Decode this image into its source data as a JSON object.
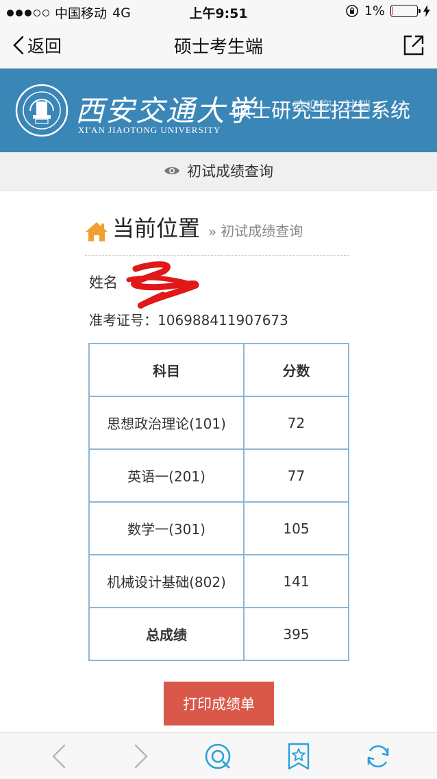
{
  "status_bar": {
    "carrier": "中国移动",
    "network": "4G",
    "time": "上午9:51",
    "battery": "1%",
    "battery_level": 0.01
  },
  "nav": {
    "back_label": "返回",
    "title": "硕士考生端"
  },
  "banner": {
    "university_name": "西安交通大学",
    "university_en": "XI'AN JIAOTONG UNIVERSITY",
    "system_title": "硕士研究生招生系统",
    "welcome": "欢迎您 · 注销"
  },
  "section": {
    "label": "初试成绩查询"
  },
  "location": {
    "title": "当前位置",
    "separator": "»",
    "page": "初试成绩查询"
  },
  "candidate": {
    "name_label": "姓名",
    "id_label": "准考证号：",
    "id_value": "106988411907673"
  },
  "scores": {
    "headers": [
      "科目",
      "分数"
    ],
    "rows": [
      {
        "subject": "思想政治理论(101)",
        "score": "72"
      },
      {
        "subject": "英语一(201)",
        "score": "77"
      },
      {
        "subject": "数学一(301)",
        "score": "105"
      },
      {
        "subject": "机械设计基础(802)",
        "score": "141"
      }
    ],
    "total_label": "总成绩",
    "total_score": "395"
  },
  "actions": {
    "print_label": "打印成绩单"
  },
  "colors": {
    "banner": "#3a86b7",
    "table_border": "#8eb5d4",
    "print_button": "#d9584a",
    "home_icon": "#f0a030",
    "toolbar_icon": "#2aa0d8"
  },
  "icons": [
    "chevron-left-icon",
    "share-icon",
    "eye-icon",
    "home-icon",
    "back-arrow-icon",
    "forward-arrow-icon",
    "browser-home-icon",
    "bookmark-star-icon",
    "refresh-icon"
  ]
}
